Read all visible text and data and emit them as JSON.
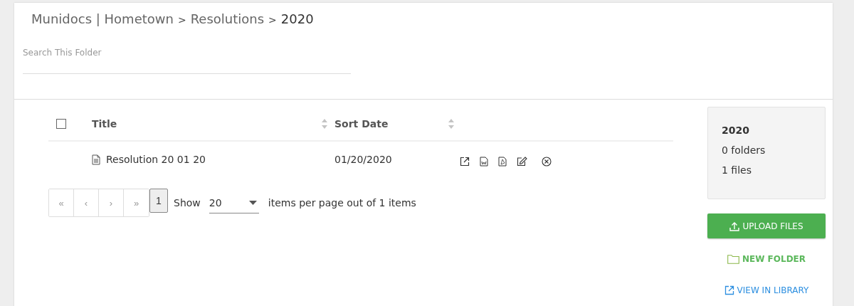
{
  "breadcrumb": {
    "separator": ">",
    "items": [
      "Munidocs | Hometown",
      "Resolutions",
      "2020"
    ]
  },
  "search": {
    "placeholder": "Search This Folder"
  },
  "table": {
    "select_all": {
      "checked": false
    },
    "columns": [
      {
        "label": "Title",
        "sortable": true
      },
      {
        "label": "Sort Date",
        "sortable": true
      }
    ],
    "rows": [
      {
        "title": "Resolution 20 01 20",
        "date": "01/20/2020"
      }
    ]
  },
  "pagination": {
    "first": "«",
    "prev": "‹",
    "next": "›",
    "last": "»",
    "pages": [
      {
        "label": "1",
        "selected": true
      }
    ],
    "show_label": "Show",
    "page_size": "20",
    "summary": "items per page out of 1 items"
  },
  "folder_info": {
    "name": "2020",
    "folders": "0 folders",
    "files": "1 files"
  },
  "actions": [
    {
      "kind": "primary",
      "label": "UPLOAD FILES"
    },
    {
      "kind": "folder",
      "label": "NEW FOLDER"
    },
    {
      "kind": "link",
      "label": "VIEW IN LIBRARY"
    }
  ]
}
